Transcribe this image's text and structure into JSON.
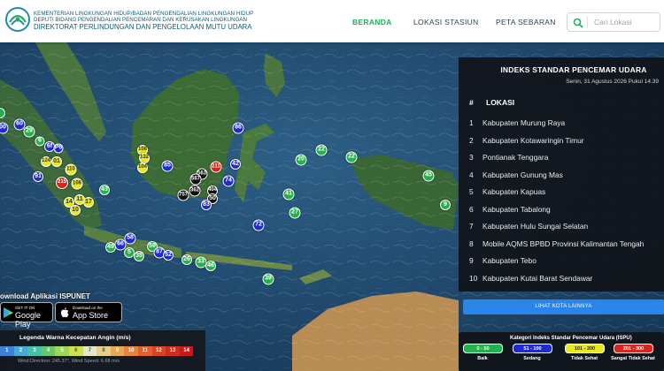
{
  "header": {
    "org_line1": "KEMENTERIAN LINGKUNGAN HIDUP/BADAN PENGENDALIAN LINGKUNGAN HIDUP",
    "org_line2": "DEPUTI BIDANG PENGENDALIAN PENCEMARAN DAN KERUSAKAN LINGKUNGAN",
    "org_line3": "DIREKTORAT PERLINDUNGAN DAN PENGELOLAAN MUTU UDARA",
    "nav": [
      "BERANDA",
      "LOKASI STASIUN",
      "PETA SEBARAN"
    ],
    "search_placeholder": "Cari Lokasi"
  },
  "markers": [
    {
      "label": "",
      "color": "green"
    },
    {
      "label": "00",
      "color": "blue"
    },
    {
      "label": "60",
      "color": "blue"
    },
    {
      "label": "29",
      "color": "green"
    },
    {
      "label": "6",
      "color": "green"
    },
    {
      "label": "6f",
      "color": "blue"
    },
    {
      "label": "P6",
      "color": "blue"
    },
    {
      "label": "124",
      "color": "yellow"
    },
    {
      "label": "01",
      "color": "yellow"
    },
    {
      "label": "91",
      "color": "blue"
    },
    {
      "label": "110",
      "color": "yellow"
    },
    {
      "label": "215",
      "color": "red"
    },
    {
      "label": "108",
      "color": "yellow"
    },
    {
      "label": "43",
      "color": "green"
    },
    {
      "label": "14",
      "color": "yellow"
    },
    {
      "label": "10",
      "color": "yellow"
    },
    {
      "label": "17",
      "color": "yellow"
    },
    {
      "label": "11",
      "color": "yellow"
    },
    {
      "label": "58",
      "color": "blue"
    },
    {
      "label": "66",
      "color": "blue"
    },
    {
      "label": "49",
      "color": "green"
    },
    {
      "label": "5",
      "color": "green"
    },
    {
      "label": "35",
      "color": "green"
    },
    {
      "label": "59",
      "color": "green"
    },
    {
      "label": "87",
      "color": "blue"
    },
    {
      "label": "52",
      "color": "blue"
    },
    {
      "label": "26",
      "color": "green"
    },
    {
      "label": "33",
      "color": "green"
    },
    {
      "label": "46",
      "color": "green"
    },
    {
      "label": "39",
      "color": "green"
    },
    {
      "label": "108",
      "color": "yellow"
    },
    {
      "label": "132",
      "color": "yellow"
    },
    {
      "label": "104",
      "color": "yellow"
    },
    {
      "label": "85",
      "color": "blue"
    },
    {
      "label": "86",
      "color": "blue"
    },
    {
      "label": "563",
      "color": "black"
    },
    {
      "label": "567",
      "color": "black"
    },
    {
      "label": "211",
      "color": "red"
    },
    {
      "label": "362",
      "color": "black"
    },
    {
      "label": "757",
      "color": "black"
    },
    {
      "label": "404",
      "color": "black"
    },
    {
      "label": "50",
      "color": "black"
    },
    {
      "label": "83",
      "color": "blue"
    },
    {
      "label": "42",
      "color": "blue"
    },
    {
      "label": "74",
      "color": "blue"
    },
    {
      "label": "20",
      "color": "green"
    },
    {
      "label": "22",
      "color": "green"
    },
    {
      "label": "22",
      "color": "green"
    },
    {
      "label": "41",
      "color": "green"
    },
    {
      "label": "27",
      "color": "green"
    },
    {
      "label": "72",
      "color": "blue"
    },
    {
      "label": "45",
      "color": "green"
    },
    {
      "label": "9",
      "color": "green"
    }
  ],
  "panel": {
    "title": "INDEKS STANDAR PENCEMAR UDARA",
    "date": "Senin, 31 Agustus 2026 Pukul 14.39",
    "col_no": "#",
    "col_loc": "LOKASI",
    "rows": [
      {
        "no": "1",
        "loc": "Kabupaten Murung Raya"
      },
      {
        "no": "2",
        "loc": "Kabupaten Kotawaringin Timur"
      },
      {
        "no": "3",
        "loc": "Pontianak Tenggara"
      },
      {
        "no": "4",
        "loc": "Kabupaten Gunung Mas"
      },
      {
        "no": "5",
        "loc": "Kabupaten Kapuas"
      },
      {
        "no": "6",
        "loc": "Kabupaten Tabalong"
      },
      {
        "no": "7",
        "loc": "Kabupaten Hulu Sungai Selatan"
      },
      {
        "no": "8",
        "loc": "Mobile AQMS BPBD Provinsi Kalimantan Tengah"
      },
      {
        "no": "9",
        "loc": "Kabupaten Tebo"
      },
      {
        "no": "10",
        "loc": "Kabupaten Kutai Barat Sendawar"
      }
    ],
    "more_button": "LIHAT KOTA LAINNYA"
  },
  "ispu_legend": {
    "title": "Kategori Indeks Standar Pencemar Udara (ISPU)",
    "items": [
      {
        "range": "0 - 50",
        "label": "Baik",
        "color": "#22b24c"
      },
      {
        "range": "51 - 100",
        "label": "Sedang",
        "color": "#1d2bd1"
      },
      {
        "range": "101 - 200",
        "label": "Tidak Sehat",
        "color": "#e7e81e"
      },
      {
        "range": "201 - 300",
        "label": "Sangat Tidak Sehat",
        "color": "#d7261e"
      }
    ]
  },
  "download": {
    "title": "ownload Aplikasi ISPUNET",
    "google_small": "GET IT ON",
    "google_big": "Google Play",
    "apple_small": "Download on the",
    "apple_big": "App Store"
  },
  "wind_legend": {
    "title": "Legenda Warna Kecepatan Angin (m/s)",
    "values": [
      "1",
      "2",
      "3",
      "4",
      "5",
      "6",
      "7",
      "8",
      "9",
      "10",
      "11",
      "12",
      "13",
      "14"
    ],
    "colors": [
      "#3f7fd8",
      "#4aa8d6",
      "#48c0a4",
      "#66c76e",
      "#9fd65a",
      "#cfe24c",
      "#e3e9c8",
      "#e8d08b",
      "#e9a75a",
      "#e6833f",
      "#e0602f",
      "#d94428",
      "#d02b22",
      "#c41a1a"
    ],
    "info": "Wind Direction: 245.37°, Wind Speed: 6.68 m/s"
  }
}
